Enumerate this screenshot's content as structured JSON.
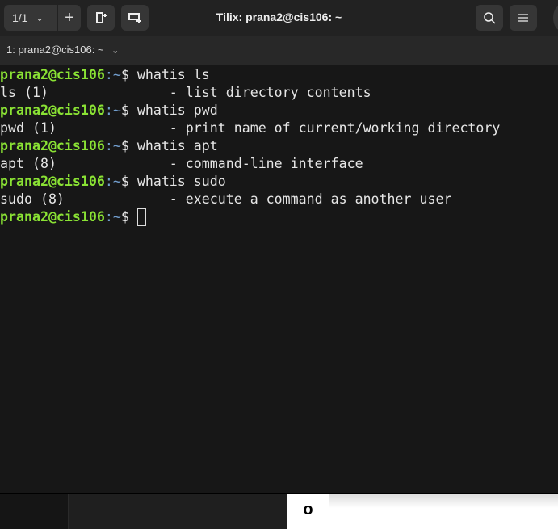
{
  "header": {
    "session_counter": "1/1",
    "title": "Tilix: prana2@cis106: ~"
  },
  "tab": {
    "label": "1: prana2@cis106: ~"
  },
  "terminal": {
    "prompt_user": "prana2@cis106",
    "prompt_path": ":~",
    "prompt_symbol": "$ ",
    "lines": [
      {
        "cmd": "whatis ls",
        "out": "ls (1)               - list directory contents"
      },
      {
        "cmd": "whatis pwd",
        "out": "pwd (1)              - print name of current/working directory"
      },
      {
        "cmd": "whatis apt",
        "out": "apt (8)              - command-line interface"
      },
      {
        "cmd": "whatis sudo",
        "out": "sudo (8)             - execute a command as another user"
      }
    ]
  },
  "taskbar": {
    "label": "o"
  }
}
